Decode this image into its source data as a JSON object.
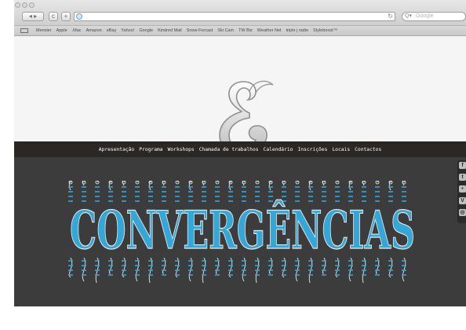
{
  "browser": {
    "search_placeholder": "Google",
    "bookmarks": [
      "Mensier",
      "Apple",
      ".Mac",
      "Amazon",
      "eBay",
      "Yahoo!",
      "Google",
      "Kindred Mail",
      "Snow Forcast",
      "Ski Cam",
      "TW Biz",
      "Weather Net",
      "triple j radio",
      "Styleboost™"
    ]
  },
  "site": {
    "nav": [
      "Apresentação",
      "Programa",
      "Workshops",
      "Chamada de trabalhos",
      "Calendário",
      "Inscrições",
      "Locais",
      "Contactos"
    ],
    "title": "CONVERGÊNCIAS",
    "social": [
      {
        "icon": "facebook-icon",
        "glyph": "f"
      },
      {
        "icon": "twitter-icon",
        "glyph": "t"
      },
      {
        "icon": "flickr-icon",
        "glyph": "•"
      },
      {
        "icon": "vimeo-icon",
        "glyph": "V"
      },
      {
        "icon": "instagram-icon",
        "glyph": "◎"
      }
    ]
  },
  "colors": {
    "nav_bg": "#2a2724",
    "hero_bg": "#3c3c3c",
    "accent_blue": "#33a7d8",
    "ornament": "#d9d9d9"
  }
}
